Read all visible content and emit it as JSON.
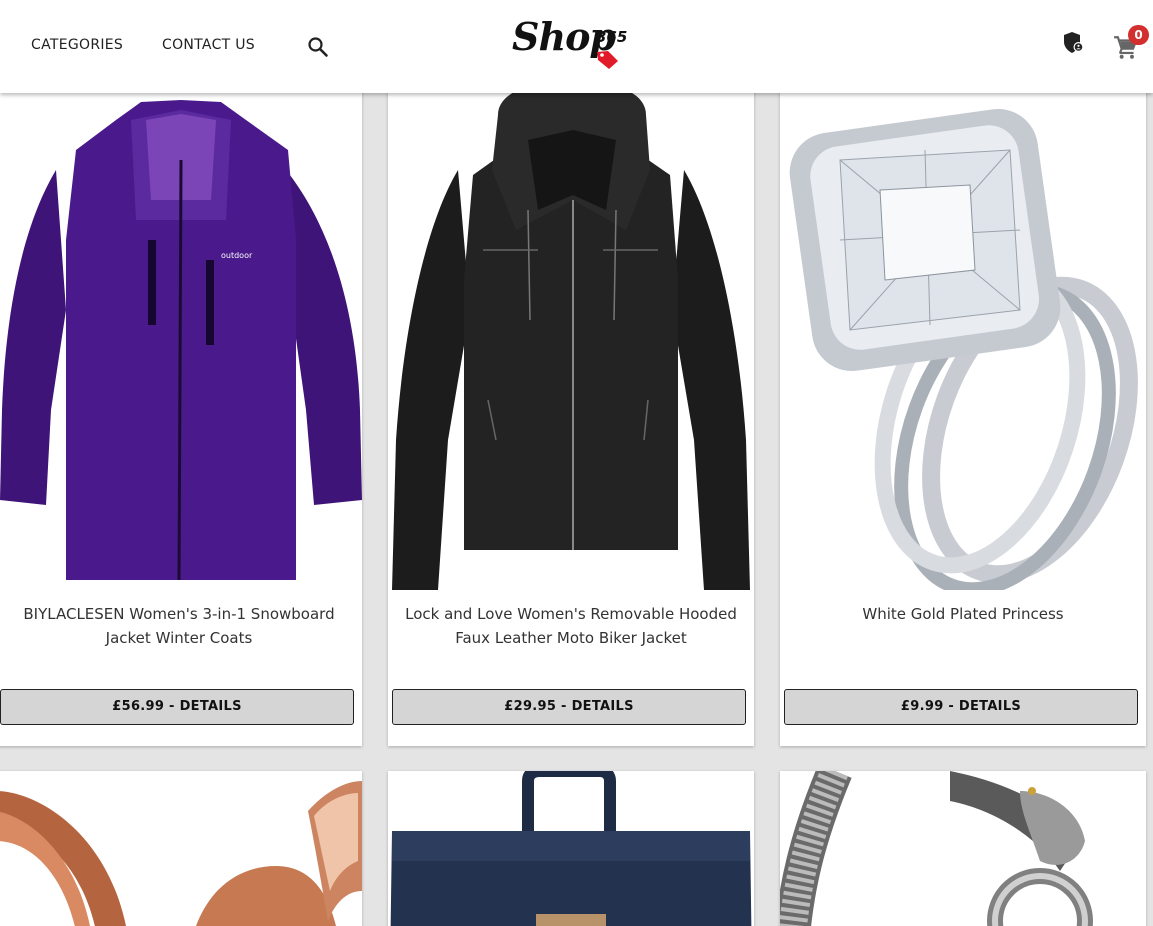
{
  "header": {
    "nav": {
      "categories": "CATEGORIES",
      "contact": "CONTACT US"
    },
    "logo": {
      "text": "Shop",
      "number": "365"
    },
    "cart_count": "0",
    "icons": [
      "search-icon",
      "shield-account-icon",
      "cart-icon"
    ]
  },
  "colors": {
    "badge": "#d32f2f",
    "button_bg": "#d5d5d5",
    "page_bg": "#e4e4e4",
    "tag_red": "#e21b2b"
  },
  "products": [
    {
      "title": "BIYLACLESEN Women's 3-in-1 Snowboard Jacket Winter Coats",
      "button": "£56.99 - DETAILS",
      "image": "purple-jacket"
    },
    {
      "title": "Lock and Love Women's Removable Hooded Faux Leather Moto Biker Jacket",
      "button": "£29.95 - DETAILS",
      "image": "black-leather-jacket"
    },
    {
      "title": "White Gold Plated Princess",
      "button": "£9.99 - DETAILS",
      "image": "diamond-ring"
    },
    {
      "title": "",
      "button": "",
      "image": "rose-gold-rings"
    },
    {
      "title": "",
      "button": "",
      "image": "navy-backpack"
    },
    {
      "title": "",
      "button": "",
      "image": "silver-dragon-bracelet"
    }
  ]
}
